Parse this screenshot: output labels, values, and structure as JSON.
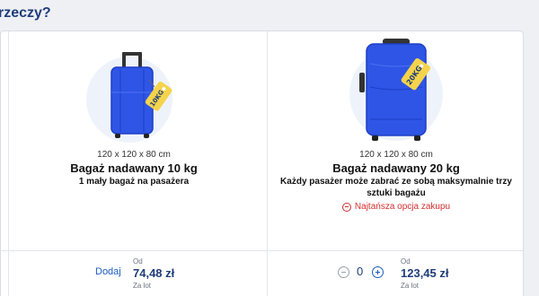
{
  "page": {
    "title": "rzeczy?"
  },
  "options": [
    {
      "dims": "120 x 120 x 80 cm",
      "name": "Bagaż nadawany 10 kg",
      "desc": "1 mały bagaż na pasażera",
      "tag": "10KG",
      "add_label": "Dodaj",
      "od": "Od",
      "price": "74,48 zł",
      "per": "Za lot"
    },
    {
      "dims": "120 x 120 x 80 cm",
      "name": "Bagaż nadawany 20 kg",
      "desc": "Każdy pasażer może zabrać ze sobą maksymalnie trzy sztuki bagażu",
      "cheapest": "Najtańsza opcja zakupu",
      "tag": "20KG",
      "quantity": "0",
      "od": "Od",
      "price": "123,45 zł",
      "per": "Za lot"
    }
  ],
  "colors": {
    "brand": "#1f3d7a",
    "accent": "#1b5dbf",
    "suitcase": "#2f55e6",
    "tag": "#f5d34a",
    "warning": "#d32f2f"
  }
}
